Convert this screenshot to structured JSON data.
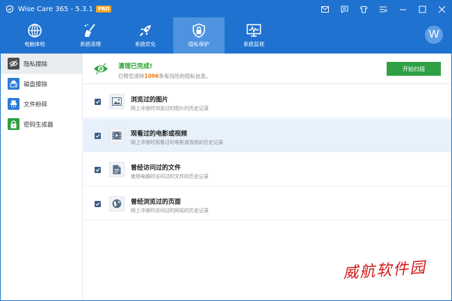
{
  "window": {
    "title": "Wise Care 365 - 5.3.1",
    "badge": "PRO"
  },
  "nav": {
    "items": [
      {
        "label": "电脑体检",
        "icon": "globe-scan-icon"
      },
      {
        "label": "系统清理",
        "icon": "broom-icon"
      },
      {
        "label": "系统优化",
        "icon": "rocket-icon"
      },
      {
        "label": "隐私保护",
        "icon": "lock-shield-icon"
      },
      {
        "label": "系统监视",
        "icon": "monitor-pulse-icon"
      }
    ],
    "active_index": 3,
    "avatar_letter": "W"
  },
  "sidebar": {
    "items": [
      {
        "label": "隐私擦除",
        "icon": "eye-slash-icon"
      },
      {
        "label": "磁盘擦除",
        "icon": "disk-eraser-icon"
      },
      {
        "label": "文件粉碎",
        "icon": "file-shredder-icon"
      },
      {
        "label": "密码生成器",
        "icon": "padlock-icon"
      }
    ],
    "active_index": 0
  },
  "status": {
    "title": "清理已完成!",
    "desc_prefix": "已帮您清除",
    "count": "1096",
    "desc_suffix": "条有风险的隐私信息。",
    "scan_button": "开始扫描"
  },
  "items": [
    {
      "title": "浏览过的图片",
      "desc": "网上冲浪时浏览过的图片的历史记录",
      "icon": "image-icon",
      "checked": true
    },
    {
      "title": "观看过的电影或视频",
      "desc": "网上冲浪时观看过的电影或视频的历史记录",
      "icon": "video-film-icon",
      "checked": true
    },
    {
      "title": "曾经访问过的文件",
      "desc": "使用电脑时访问过的文件的历史记录",
      "icon": "document-icon",
      "checked": true
    },
    {
      "title": "曾经浏览过的页面",
      "desc": "网上冲浪时访问过的网站的历史记录",
      "icon": "web-globe-icon",
      "checked": true
    }
  ],
  "watermark": "威航软件园",
  "colors": {
    "brand_blue": "#1f72cf",
    "active_nav": "#4e93df",
    "success_green": "#2fa043",
    "count_orange": "#f07a18",
    "row_highlight": "#e7f1fc"
  }
}
